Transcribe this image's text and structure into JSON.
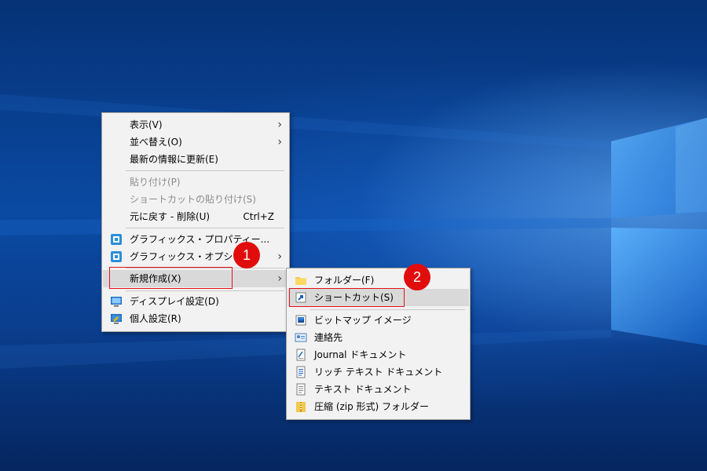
{
  "context_menu": {
    "items": [
      {
        "label": "表示(V)",
        "has_submenu": true
      },
      {
        "label": "並べ替え(O)",
        "has_submenu": true
      },
      {
        "label": "最新の情報に更新(E)"
      },
      {
        "label": "貼り付け(P)",
        "disabled": true
      },
      {
        "label": "ショートカットの貼り付け(S)",
        "disabled": true
      },
      {
        "label": "元に戻す - 削除(U)",
        "shortcut": "Ctrl+Z"
      },
      {
        "label": "グラフィックス・プロパティー...",
        "icon": "intel-graphics-icon"
      },
      {
        "label": "グラフィックス・オプション",
        "icon": "intel-graphics-icon",
        "has_submenu": true
      },
      {
        "label": "新規作成(X)",
        "has_submenu": true,
        "highlighted": true
      },
      {
        "label": "ディスプレイ設定(D)",
        "icon": "display-icon"
      },
      {
        "label": "個人設定(R)",
        "icon": "personalize-icon"
      }
    ]
  },
  "new_submenu": {
    "items": [
      {
        "label": "フォルダー(F)",
        "icon": "folder-icon"
      },
      {
        "label": "ショートカット(S)",
        "icon": "shortcut-icon",
        "highlighted": true
      },
      {
        "label": "ビットマップ イメージ",
        "icon": "bitmap-icon"
      },
      {
        "label": "連絡先",
        "icon": "contact-icon"
      },
      {
        "label": "Journal ドキュメント",
        "icon": "journal-icon"
      },
      {
        "label": "リッチ テキスト ドキュメント",
        "icon": "rtf-icon"
      },
      {
        "label": "テキスト ドキュメント",
        "icon": "text-doc-icon"
      },
      {
        "label": "圧縮 (zip 形式) フォルダー",
        "icon": "zip-folder-icon"
      }
    ]
  },
  "markers": [
    "1",
    "2"
  ],
  "colors": {
    "marker": "#e10d0d",
    "highlight": "#d9d9d9",
    "menu_bg": "#f2f2f2"
  }
}
